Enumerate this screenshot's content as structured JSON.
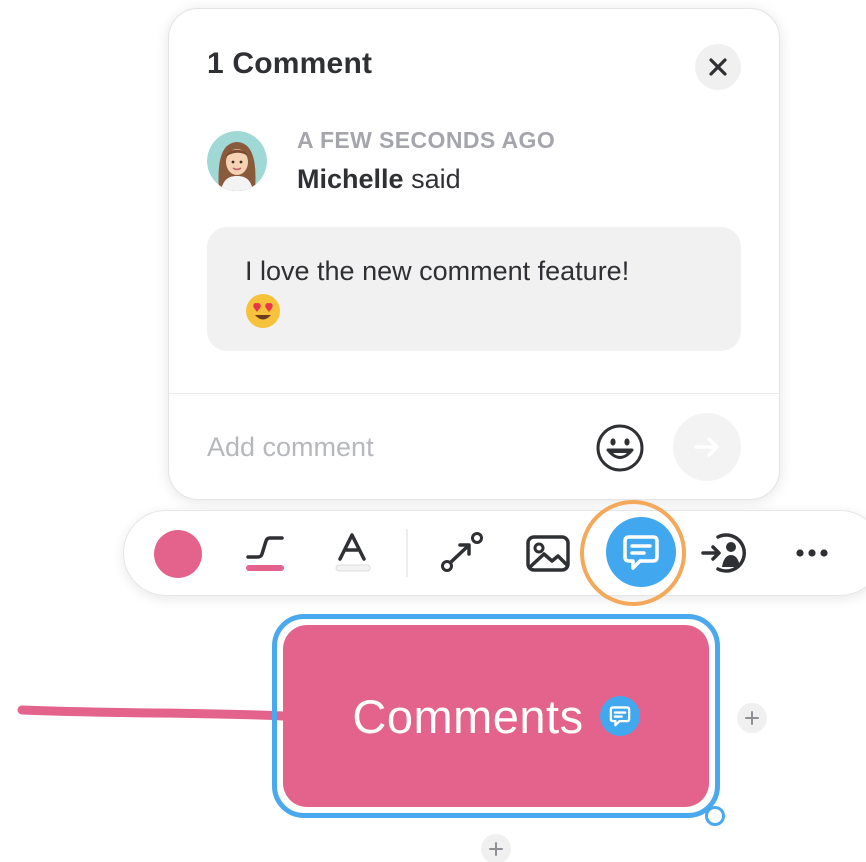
{
  "comment_panel": {
    "title": "1 Comment",
    "comment": {
      "timestamp": "A FEW SECONDS AGO",
      "author": "Michelle",
      "said": "said",
      "text": "I love the new comment feature!",
      "emoji": "heart-eyes-emoji"
    },
    "input_placeholder": "Add comment",
    "icons": {
      "close": "close-icon",
      "emoji_picker": "smiley-icon",
      "send": "arrow-right-icon"
    }
  },
  "toolbar": {
    "items": [
      {
        "name": "color-swatch",
        "color": "#e3638c"
      },
      {
        "name": "line-style-icon"
      },
      {
        "name": "text-style-icon"
      },
      {
        "name": "connect-icon"
      },
      {
        "name": "image-icon"
      },
      {
        "name": "comment-icon",
        "active": true
      },
      {
        "name": "assign-icon"
      },
      {
        "name": "more-icon"
      }
    ]
  },
  "canvas": {
    "node": {
      "label": "Comments",
      "has_comment": true,
      "selected": true
    }
  },
  "colors": {
    "node_fill": "#e3638c",
    "selection": "#4aa9ee",
    "accent_blue": "#41a8f0",
    "highlight_ring": "#f4a85a",
    "text_dark": "#2f3033",
    "text_muted": "#a4a6ab"
  }
}
